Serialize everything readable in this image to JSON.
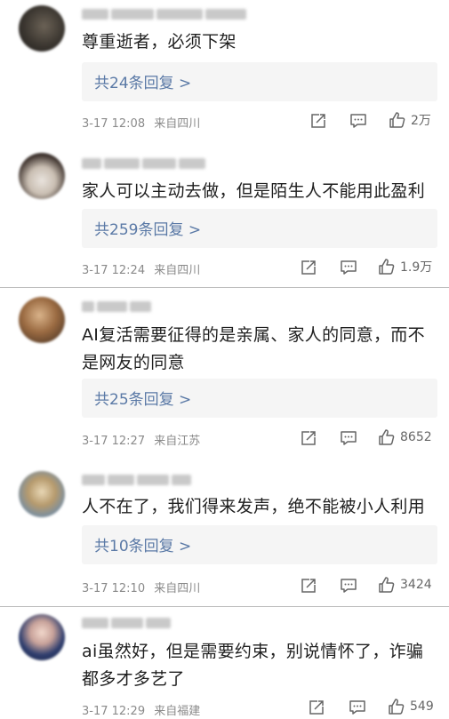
{
  "comments": [
    {
      "text": "尊重逝者，必须下架",
      "replies": "共24条回复 >",
      "time": "3-17 12:08",
      "location": "来自四川",
      "likes": "2万"
    },
    {
      "text": "家人可以主动去做，但是陌生人不能用此盈利",
      "replies": "共259条回复 >",
      "time": "3-17 12:24",
      "location": "来自四川",
      "likes": "1.9万"
    },
    {
      "text": "AI复活需要征得的是亲属、家人的同意，而不是网友的同意",
      "replies": "共25条回复 >",
      "time": "3-17 12:27",
      "location": "来自江苏",
      "likes": "8652"
    },
    {
      "text": "人不在了，我们得来发声，绝不能被小人利用",
      "replies": "共10条回复 >",
      "time": "3-17 12:10",
      "location": "来自四川",
      "likes": "3424"
    },
    {
      "text": "ai虽然好，但是需要约束，别说情怀了，诈骗都多才多艺了",
      "replies": "",
      "time": "3-17 12:29",
      "location": "来自福建",
      "likes": "549"
    }
  ]
}
